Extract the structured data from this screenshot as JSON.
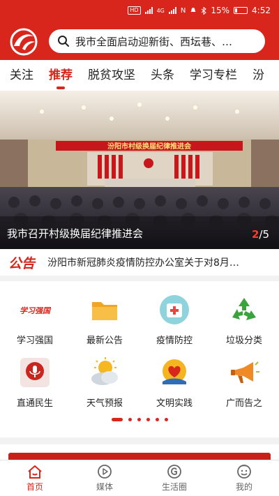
{
  "status": {
    "battery": "15%",
    "time": "4:52",
    "network_badge": "HD",
    "network_type": "4G"
  },
  "header": {
    "search_text": "我市全面启动迎新街、西坛巷、…"
  },
  "tabs": [
    {
      "label": "关注"
    },
    {
      "label": "推荐"
    },
    {
      "label": "脱贫攻坚"
    },
    {
      "label": "头条"
    },
    {
      "label": "学习专栏"
    },
    {
      "label": "汾"
    }
  ],
  "banner": {
    "stage_banner": "汾阳市村级换届纪律推进会",
    "caption": "我市召开村级换届纪律推进会",
    "current": "2",
    "total": "/5"
  },
  "notice": {
    "tag": "公告",
    "text": "汾阳市新冠肺炎疫情防控办公室关于对8月…"
  },
  "services": [
    {
      "label": "学习强国",
      "icon": "xuexi-qiangguo-icon",
      "logo_text": "学习强国"
    },
    {
      "label": "最新公告",
      "icon": "folder-icon"
    },
    {
      "label": "疫情防控",
      "icon": "medical-kit-icon"
    },
    {
      "label": "垃圾分类",
      "icon": "recycle-icon"
    },
    {
      "label": "直通民生",
      "icon": "microphone-icon"
    },
    {
      "label": "天气预报",
      "icon": "weather-icon"
    },
    {
      "label": "文明实践",
      "icon": "heart-hands-icon"
    },
    {
      "label": "广而告之",
      "icon": "megaphone-icon"
    }
  ],
  "pager": {
    "count": 6,
    "active": 0
  },
  "bottom_nav": [
    {
      "label": "首页",
      "icon": "home-icon"
    },
    {
      "label": "媒体",
      "icon": "play-icon"
    },
    {
      "label": "生活圈",
      "icon": "life-circle-icon"
    },
    {
      "label": "我的",
      "icon": "profile-icon"
    }
  ],
  "colors": {
    "brand": "#d9261c",
    "active_nav": "#d9261c"
  }
}
